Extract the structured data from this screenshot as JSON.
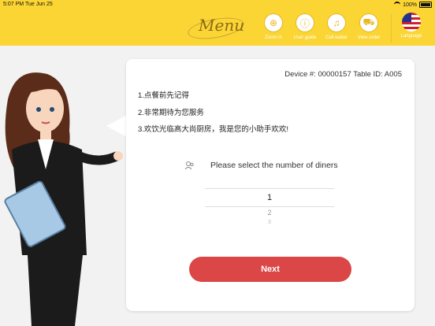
{
  "status": {
    "time": "5:07 PM",
    "date": "Tue Jun 25",
    "battery": "100%"
  },
  "header": {
    "logo": "Menu",
    "tools": [
      {
        "label": "Zoom in",
        "icon": "zoom-icon"
      },
      {
        "label": "User guide",
        "icon": "info-icon"
      },
      {
        "label": "Call waiter",
        "icon": "bell-icon"
      },
      {
        "label": "View order",
        "icon": "cart-icon"
      }
    ],
    "language": {
      "label": "Language",
      "icon": "us-flag-icon"
    }
  },
  "card": {
    "device": "Device #: 00000157 Table ID: A005",
    "lines": [
      "1.点餐前先记得",
      "2.非常期待为您服务",
      "3.欢饮光临高大尚厨房，我是您的小助手欢欢!"
    ],
    "diners_prompt": "Please select the number of diners",
    "picker": [
      "1",
      "2",
      "3"
    ],
    "next": "Next"
  },
  "colors": {
    "header": "#fbd533",
    "next": "#db4646"
  }
}
